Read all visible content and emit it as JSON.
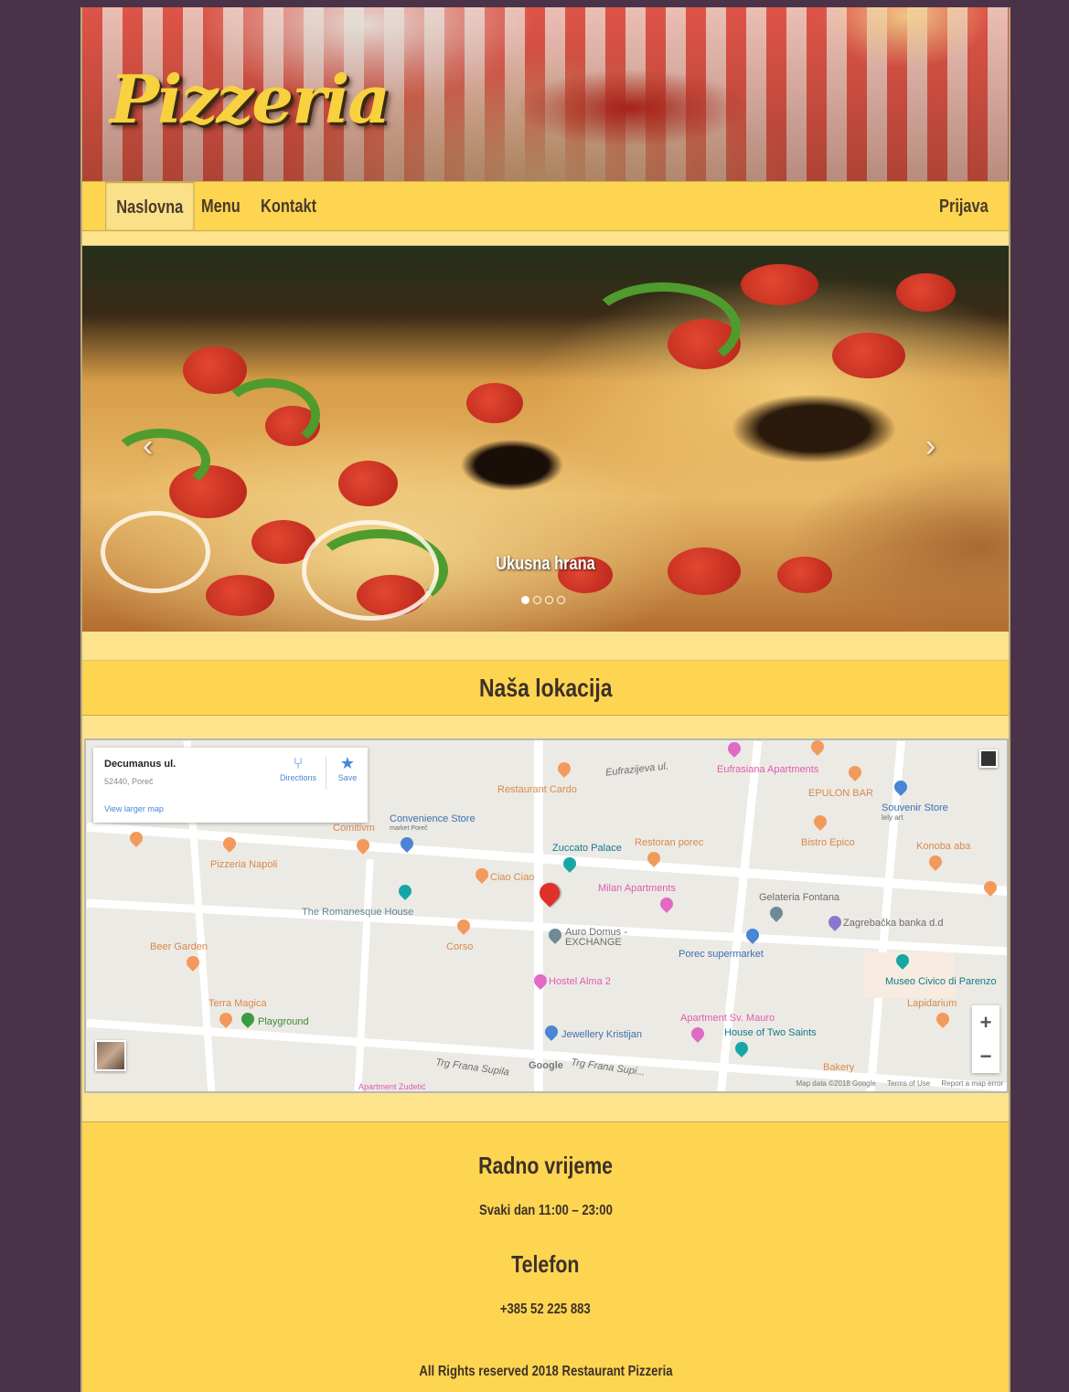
{
  "header": {
    "logo": "Pizzeria"
  },
  "nav": {
    "items": [
      {
        "label": "Naslovna",
        "active": true
      },
      {
        "label": "Menu",
        "active": false
      },
      {
        "label": "Kontakt",
        "active": false
      }
    ],
    "login": "Prijava"
  },
  "carousel": {
    "caption": "Ukusna hrana",
    "slide_count": 4,
    "active_slide": 1
  },
  "location": {
    "title": "Naša lokacija"
  },
  "map": {
    "place_title": "Decumanus ul.",
    "place_address": "52440, Poreč",
    "larger_map": "View larger map",
    "directions": "Directions",
    "save": "Save",
    "labels": {
      "eufrazijeva": "Eufrazijeva ul.",
      "eufrasiana_apts": "Eufrasiana Apartments",
      "restaurant_cardo": "Restaurant Cardo",
      "epulon_bar": "EPULON BAR",
      "souvenir_store": "Souvenir Store",
      "souvenir_sub": "lely art",
      "comitivm": "Comitivm",
      "convenience_store": "Convenience Store",
      "convenience_sub": "market Poreč",
      "zuccato_palace": "Zuccato Palace",
      "restoran_porec": "Restoran porec",
      "bistro_epico": "Bistro Epico",
      "konoba_aba": "Konoba aba",
      "pizzeria_napoli": "Pizzeria Napoli",
      "ciao_ciao": "Ciao Ciao",
      "milan_apts": "Milan Apartments",
      "gelateria_fontana": "Gelateria Fontana",
      "romanesque_house": "The Romanesque House",
      "zagrebacka": "Zagrebačka banka d.d",
      "auro_domus": "Auro Domus -",
      "exchange": "EXCHANGE",
      "beer_garden": "Beer Garden",
      "corso": "Corso",
      "porec_supermarket": "Porec supermarket",
      "museo_civico": "Museo Civico di Parenzo",
      "hostel_alma": "Hostel Alma 2",
      "lapidarium": "Lapidarium",
      "terra_magica": "Terra Magica",
      "playground": "Playground",
      "apartment_sv_mauro": "Apartment Sv. Mauro",
      "house_two_saints": "House of Two Saints",
      "jewellery": "Jewellery Kristijan",
      "trg_frana_supila": "Trg Frana Supila",
      "trg_frana_supila_2": "Trg Frana Supi...",
      "bakery": "Bakery",
      "apartment_zudetic": "Apartment Zudetić"
    },
    "google": "Google",
    "attribution": [
      "Map data ©2018 Google",
      "Terms of Use",
      "Report a map error"
    ],
    "zoom_in": "+",
    "zoom_out": "−"
  },
  "footer": {
    "hours_title": "Radno vrijeme",
    "hours": "Svaki dan 11:00 – 23:00",
    "phone_title": "Telefon",
    "phone": "+385 52 225 883",
    "copyright": "All Rights reserved 2018 Restaurant Pizzeria"
  },
  "colors": {
    "background": "#4a3348",
    "page": "#fde48c",
    "nav": "#fdd551",
    "logo": "#f7d23e"
  }
}
